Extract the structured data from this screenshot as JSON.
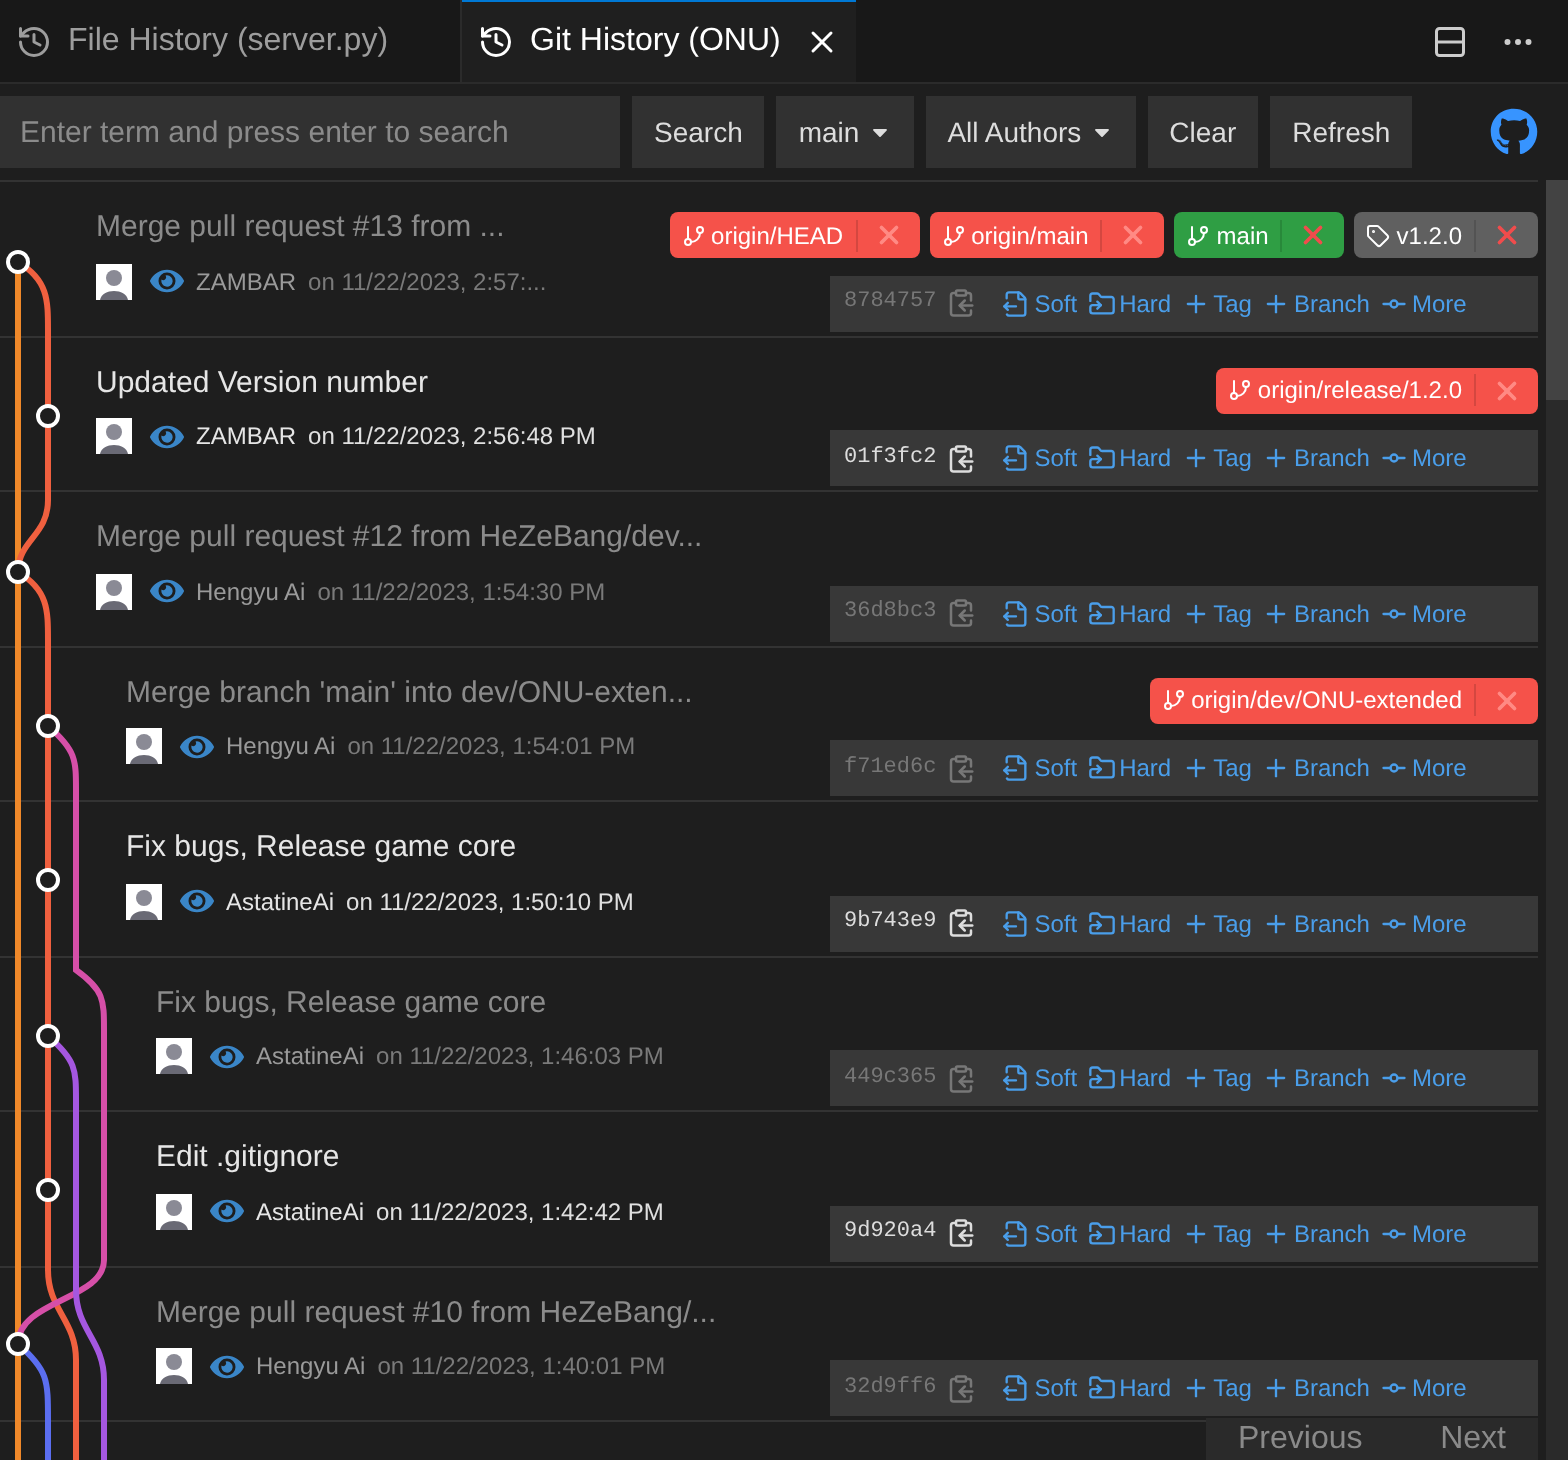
{
  "tabs": [
    {
      "label": "File History (server.py)",
      "selected": false
    },
    {
      "label": "Git History (ONU)",
      "selected": true
    }
  ],
  "toolbar": {
    "search": {
      "placeholder": "Enter term and press enter to search"
    },
    "buttons": [
      {
        "label": "Search",
        "kind": "button"
      },
      {
        "label": "main",
        "kind": "dropdown"
      },
      {
        "label": "All Authors",
        "kind": "dropdown"
      },
      {
        "label": "Clear",
        "kind": "button"
      },
      {
        "label": "Refresh",
        "kind": "button"
      }
    ]
  },
  "commits": [
    {
      "title": "Merge pull request #13 from ...",
      "dimmed": true,
      "author": "ZAMBAR",
      "date": "on 11/22/2023, 2:57:...",
      "refs": [
        {
          "label": "origin/HEAD",
          "kind": "remote"
        },
        {
          "label": "origin/main",
          "kind": "remote"
        },
        {
          "label": "main",
          "kind": "local"
        },
        {
          "label": "v1.2.0",
          "kind": "tag"
        }
      ],
      "hash": "8784757",
      "actions": [
        "Soft",
        "Hard",
        "Tag",
        "Branch",
        "More"
      ]
    },
    {
      "title": "Updated Version number",
      "dimmed": false,
      "author": "ZAMBAR",
      "date": "on 11/22/2023, 2:56:48 PM",
      "refs": [
        {
          "label": "origin/release/1.2.0",
          "kind": "remote"
        }
      ],
      "hash": "01f3fc2",
      "actions": [
        "Soft",
        "Hard",
        "Tag",
        "Branch",
        "More"
      ]
    },
    {
      "title": "Merge pull request #12 from HeZeBang/dev...",
      "dimmed": true,
      "author": "Hengyu Ai",
      "date": "on 11/22/2023, 1:54:30 PM",
      "hash": "36d8bc3",
      "actions": [
        "Soft",
        "Hard",
        "Tag",
        "Branch",
        "More"
      ]
    },
    {
      "title": "Merge branch 'main' into dev/ONU-exten...",
      "dimmed": true,
      "author": "Hengyu Ai",
      "date": "on 11/22/2023, 1:54:01 PM",
      "refs": [
        {
          "label": "origin/dev/ONU-extended",
          "kind": "remote"
        }
      ],
      "hash": "f71ed6c",
      "actions": [
        "Soft",
        "Hard",
        "Tag",
        "Branch",
        "More"
      ]
    },
    {
      "title": "Fix bugs, Release game core",
      "dimmed": false,
      "author": "AstatineAi",
      "date": "on 11/22/2023, 1:50:10 PM",
      "hash": "9b743e9",
      "actions": [
        "Soft",
        "Hard",
        "Tag",
        "Branch",
        "More"
      ]
    },
    {
      "title": "Fix bugs, Release game core",
      "dimmed": true,
      "author": "AstatineAi",
      "date": "on 11/22/2023, 1:46:03 PM",
      "hash": "449c365",
      "actions": [
        "Soft",
        "Hard",
        "Tag",
        "Branch",
        "More"
      ]
    },
    {
      "title": "Edit .gitignore",
      "dimmed": false,
      "author": "AstatineAi",
      "date": "on 11/22/2023, 1:42:42 PM",
      "hash": "9d920a4",
      "actions": [
        "Soft",
        "Hard",
        "Tag",
        "Branch",
        "More"
      ]
    },
    {
      "title": "Merge pull request #10 from HeZeBang/...",
      "dimmed": true,
      "author": "Hengyu Ai",
      "date": "on 11/22/2023, 1:40:01 PM",
      "hash": "32d9ff6",
      "actions": [
        "Soft",
        "Hard",
        "Tag",
        "Branch",
        "More"
      ]
    }
  ],
  "pagination": [
    "Previous",
    "Next"
  ]
}
